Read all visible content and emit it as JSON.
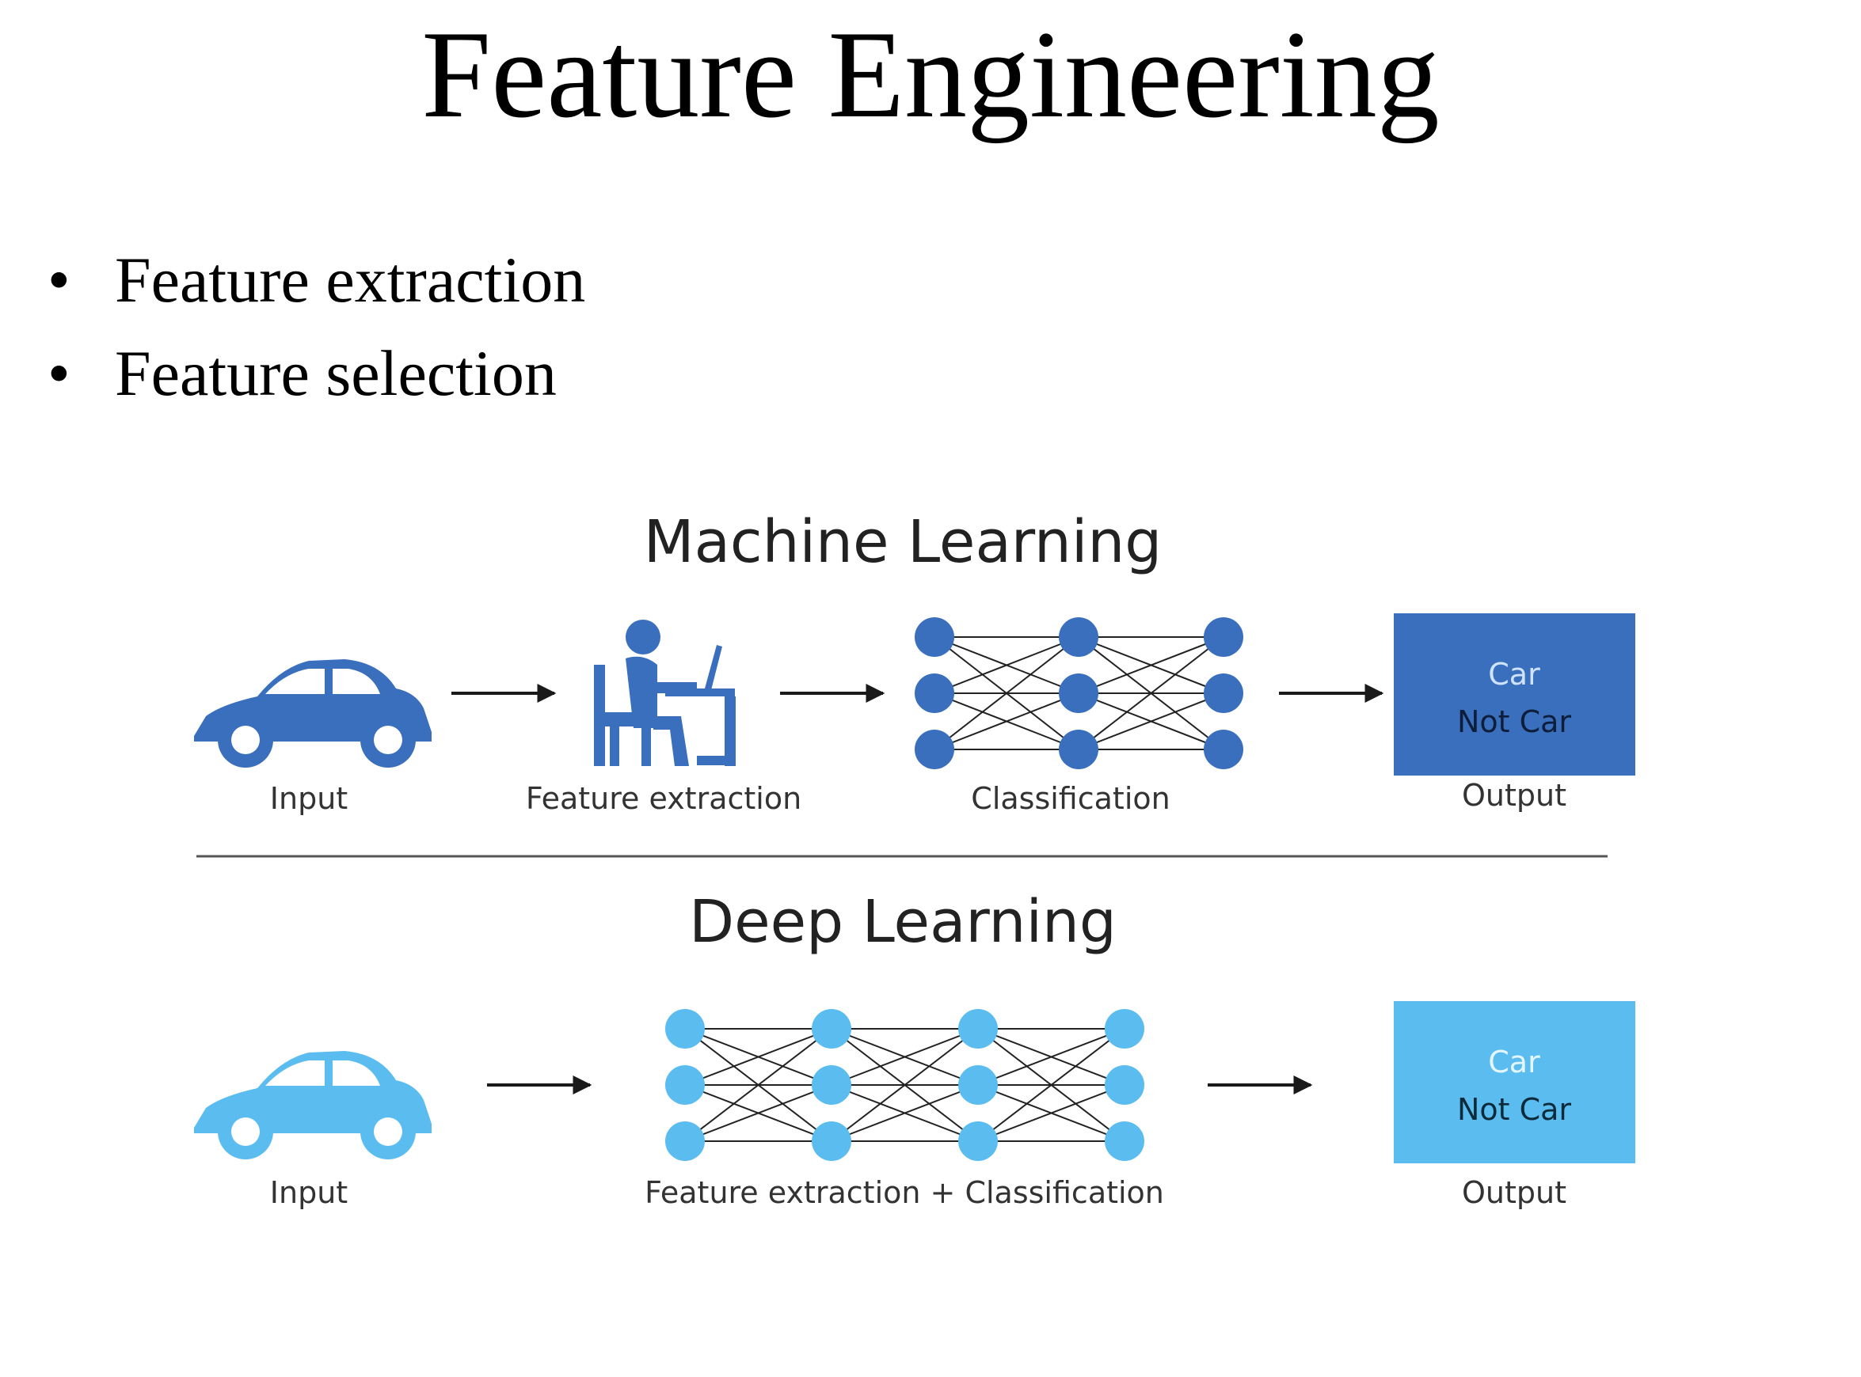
{
  "slide": {
    "title": "Feature Engineering",
    "bullet_char": "•",
    "bullets": [
      "Feature extraction",
      "Feature selection"
    ]
  },
  "diagram": {
    "colors": {
      "ml_blue": "#3a6fbd",
      "dl_blue": "#5bbcf0",
      "text_dark": "#333333",
      "arrow": "#1a1a1a"
    },
    "machine_learning": {
      "title": "Machine Learning",
      "steps": [
        "Input",
        "Feature extraction",
        "Classification",
        "Output"
      ],
      "output_box": [
        "Car",
        "Not Car"
      ],
      "icons": [
        "car-icon",
        "person-at-desk-icon",
        "neural-network-icon"
      ]
    },
    "deep_learning": {
      "title": "Deep Learning",
      "steps": [
        "Input",
        "Feature extraction + Classification",
        "Output"
      ],
      "output_box": [
        "Car",
        "Not Car"
      ],
      "icons": [
        "car-icon",
        "neural-network-icon"
      ]
    }
  }
}
